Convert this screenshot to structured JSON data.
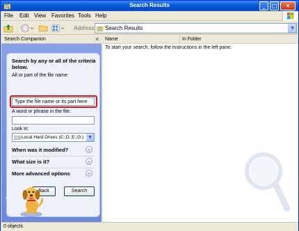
{
  "window": {
    "title": "Search Results",
    "controls": {
      "minimize": "_",
      "maximize": "□",
      "close": "✕"
    }
  },
  "menu": [
    "File",
    "Edit",
    "View",
    "Favorites",
    "Tools",
    "Help"
  ],
  "toolbar": {
    "address_label": "Address",
    "address_value": "Search Results"
  },
  "left_pane": {
    "title": "Search Companion",
    "heading": "Search by any or all of the criteria below.",
    "filename_label": "All or part of the file name:",
    "filename_value": "Type the file name or its part here",
    "phrase_label": "A word or phrase in the file:",
    "phrase_value": "",
    "lookin_label": "Look in:",
    "lookin_value": "Local Hard Drives (C:;D:;E:;G:)",
    "options": [
      {
        "label": "When was it modified?"
      },
      {
        "label": "What size is it?"
      },
      {
        "label": "More advanced options"
      }
    ],
    "back_label": "Back",
    "search_label": "Search",
    "highlight_color": "#e0121b"
  },
  "results": {
    "columns": [
      "Name",
      "In Folder"
    ],
    "message": "To start your search, follow the instructions in the left pane."
  },
  "status": {
    "text": "0 objects"
  }
}
